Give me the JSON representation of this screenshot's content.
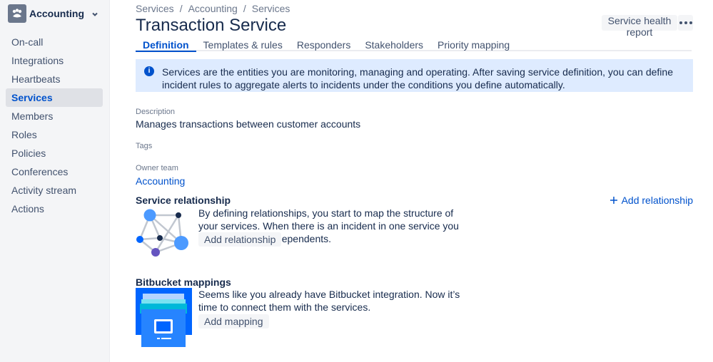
{
  "sidebar": {
    "team_name": "Accounting",
    "items": [
      {
        "label": "On-call",
        "active": false
      },
      {
        "label": "Integrations",
        "active": false
      },
      {
        "label": "Heartbeats",
        "active": false
      },
      {
        "label": "Services",
        "active": true
      },
      {
        "label": "Members",
        "active": false
      },
      {
        "label": "Roles",
        "active": false
      },
      {
        "label": "Policies",
        "active": false
      },
      {
        "label": "Conferences",
        "active": false
      },
      {
        "label": "Activity stream",
        "active": false
      },
      {
        "label": "Actions",
        "active": false
      }
    ]
  },
  "breadcrumb": [
    "Services",
    "Accounting",
    "Services"
  ],
  "page_title": "Transaction Service",
  "header": {
    "report_button": "Service health report",
    "more_icon": "more-horizontal-icon"
  },
  "tabs": [
    {
      "label": "Definition",
      "active": true
    },
    {
      "label": "Templates & rules",
      "active": false
    },
    {
      "label": "Responders",
      "active": false
    },
    {
      "label": "Stakeholders",
      "active": false
    },
    {
      "label": "Priority mapping",
      "active": false
    }
  ],
  "info_banner": {
    "icon": "info-icon",
    "text": "Services are the entities you are monitoring, managing and operating. After saving service definition, you can define incident rules to aggregate alerts to incidents under the conditions you define automatically."
  },
  "description": {
    "label": "Description",
    "value": "Manages transactions between customer accounts"
  },
  "tags": {
    "label": "Tags"
  },
  "owner_team": {
    "label": "Owner team",
    "value": "Accounting"
  },
  "service_relationship": {
    "title": "Service relationship",
    "add_link": "Add relationship",
    "text": "By defining relationships, you start to map the structure of your services. When there is an incident in one service you quickly grasp the dependents.",
    "button": "Add relationship"
  },
  "bitbucket": {
    "title": "Bitbucket mappings",
    "text": "Seems like you already have Bitbucket integration. Now it’s time to connect them with the services.",
    "button": "Add mapping"
  },
  "colors": {
    "accent": "#0052cc",
    "banner": "#deebff",
    "sidebar": "#f4f5f7",
    "active_item": "#dfe1e6"
  }
}
